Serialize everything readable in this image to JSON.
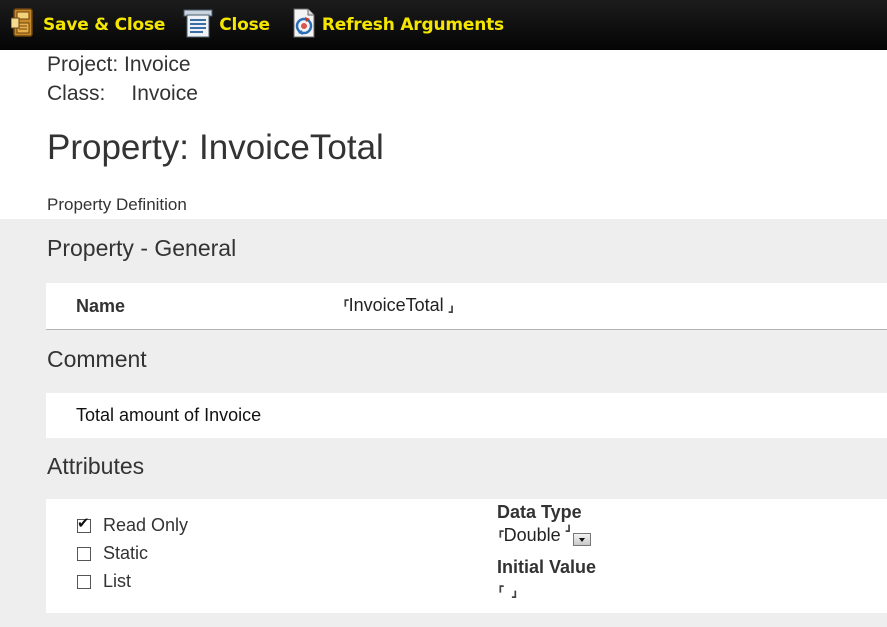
{
  "toolbar": {
    "save_close_label": "Save & Close",
    "close_label": "Close",
    "refresh_label": "Refresh Arguments",
    "text_color": "#f5e600",
    "background": "#0d0d0d",
    "icons": [
      "save-disk-icon",
      "close-document-icon",
      "refresh-icon"
    ]
  },
  "header": {
    "project_label": "Project:",
    "project_value": "Invoice",
    "class_label": "Class:",
    "class_value": "Invoice",
    "title_prefix": "Property:",
    "title_value": "InvoiceTotal",
    "subheading": "Property Definition"
  },
  "sections": {
    "general": "Property - General",
    "comment": "Comment",
    "attributes": "Attributes"
  },
  "fields": {
    "name_label": "Name",
    "name_value": "InvoiceTotal",
    "field_start_marker": "┏",
    "field_end_marker": "┛",
    "comment_value": "Total amount of Invoice"
  },
  "attributes": {
    "checkboxes": [
      {
        "label": "Read Only",
        "checked": true
      },
      {
        "label": "Static",
        "checked": false
      },
      {
        "label": "List",
        "checked": false
      }
    ],
    "data_type_label": "Data Type",
    "data_type_value": "Double",
    "initial_value_label": "Initial Value",
    "initial_value": ""
  },
  "colors": {
    "panel_background": "#eeeeee",
    "card_background": "#ffffff"
  }
}
